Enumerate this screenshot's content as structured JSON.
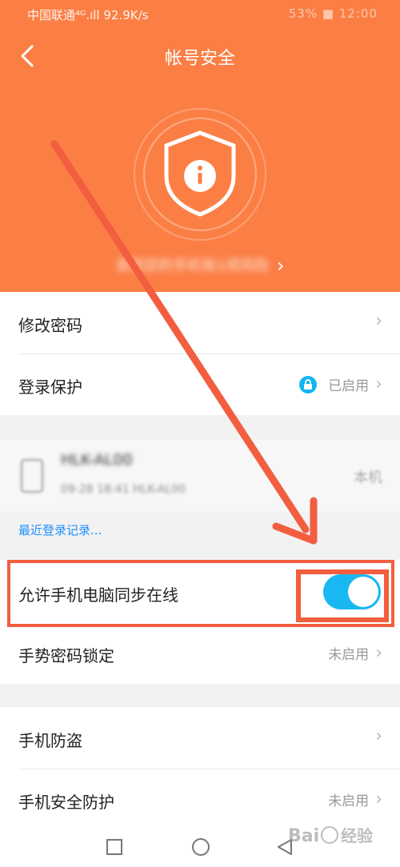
{
  "status_bar": {
    "left": "中国联通⁴ᴳ.ıll  92.9K/s",
    "right": "53% ■ 12:00"
  },
  "header": {
    "title": "帐号安全",
    "risk_text": "发现您的手机有1项风险"
  },
  "security_rows": [
    {
      "label": "修改密码",
      "value": ""
    },
    {
      "label": "登录保护",
      "value": "已启用"
    }
  ],
  "device": {
    "name": "HLK-AL00",
    "detail": "09-28 18:41 HLK-AL00",
    "tag": "本机"
  },
  "recent_login": "最近登录记录...",
  "sync_row": {
    "label": "允许手机电脑同步在线",
    "enabled": true
  },
  "gesture_row": {
    "label": "手势密码锁定",
    "value": "未启用"
  },
  "phone_rows": [
    {
      "label": "手机防盗",
      "value": ""
    },
    {
      "label": "手机安全防护",
      "value": "未启用"
    }
  ],
  "colors": {
    "header": "#fb7f45",
    "accent": "#19b8f2",
    "highlight": "#f25e3f",
    "link": "#1e90ff"
  },
  "watermark": "Bai度经验"
}
